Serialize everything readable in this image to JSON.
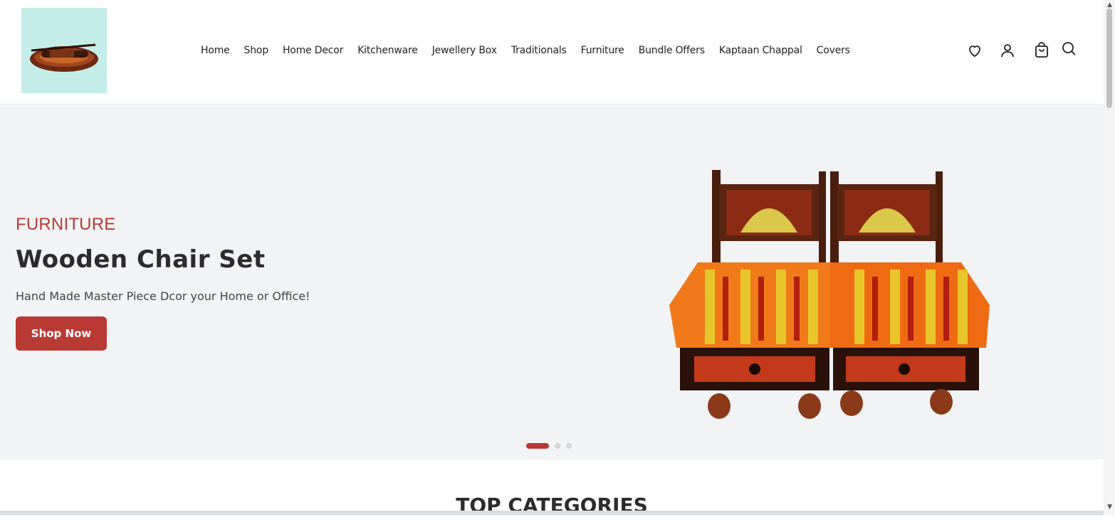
{
  "header": {
    "logo_alt": "Store logo",
    "nav": [
      "Home",
      "Shop",
      "Home Decor",
      "Kitchenware",
      "Jewellery Box",
      "Traditionals",
      "Furniture",
      "Bundle Offers",
      "Kaptaan Chappal",
      "Covers"
    ],
    "icons": {
      "wishlist": "heart-icon",
      "account": "user-icon",
      "cart": "cart-icon",
      "search": "search-icon"
    }
  },
  "hero": {
    "category": "FURNITURE",
    "title": "Wooden Chair Set",
    "subtitle": "Hand Made Master Piece Dcor your Home or Office!",
    "button": "Shop Now",
    "slides": 3,
    "active_slide": 1
  },
  "sections": {
    "top_categories": "TOP CATEGORIES"
  },
  "colors": {
    "accent": "#b93a35",
    "hero_bg": "#f2f3f5",
    "logo_bg": "#c4ede9"
  }
}
